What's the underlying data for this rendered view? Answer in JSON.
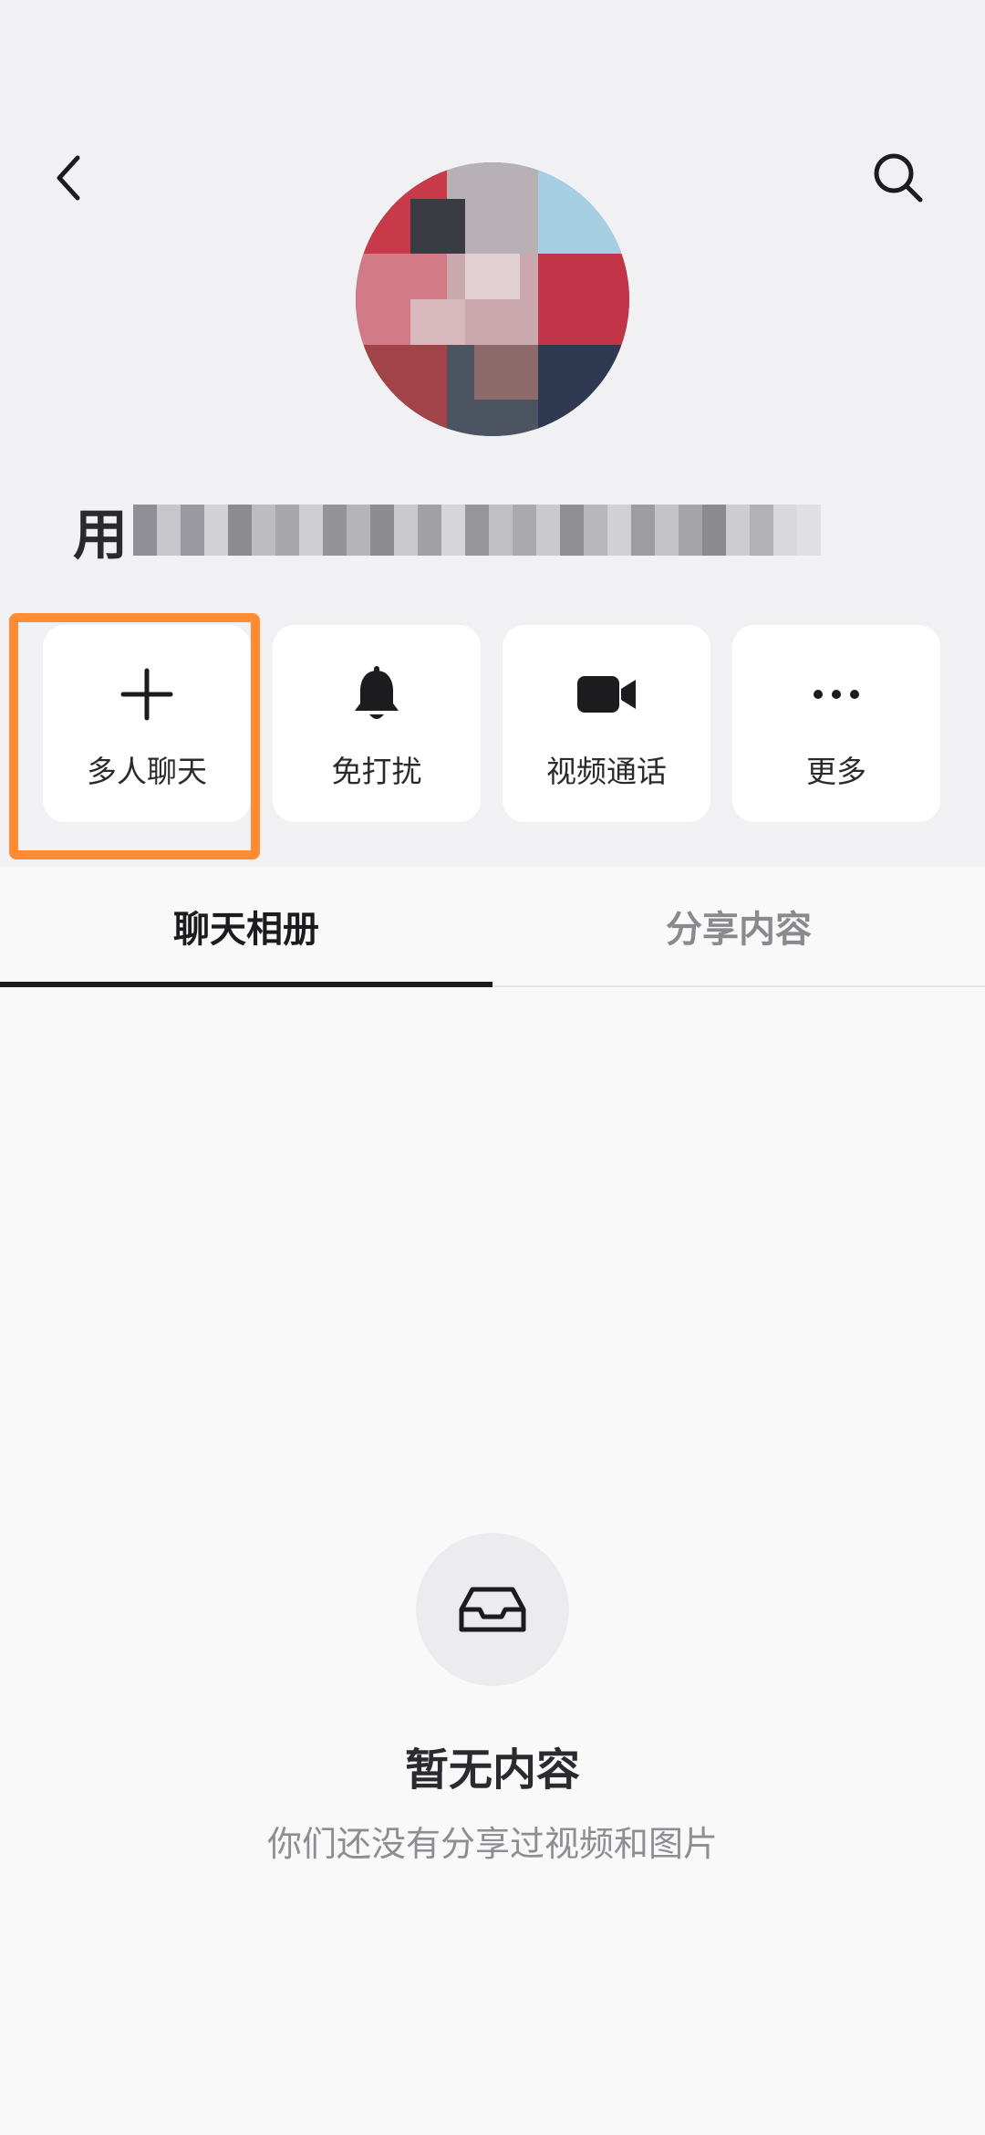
{
  "header": {
    "back_icon": "chevron-left-icon",
    "search_icon": "search-icon"
  },
  "profile": {
    "name_visible_prefix": "用",
    "name_obscured": true
  },
  "actions": [
    {
      "label": "多人聊天",
      "icon": "plus-icon"
    },
    {
      "label": "免打扰",
      "icon": "bell-icon"
    },
    {
      "label": "视频通话",
      "icon": "video-camera-icon"
    },
    {
      "label": "更多",
      "icon": "more-dots-icon"
    }
  ],
  "tabs": [
    {
      "label": "聊天相册",
      "active": true
    },
    {
      "label": "分享内容",
      "active": false
    }
  ],
  "empty_state": {
    "icon": "inbox-icon",
    "title": "暂无内容",
    "subtitle": "你们还没有分享过视频和图片"
  },
  "colors": {
    "highlight": "#ff8c33",
    "header_bg": "#f1f1f3",
    "page_bg": "#f9f9f9",
    "card_bg": "#ffffff",
    "text_primary": "#1c1c1e",
    "text_secondary": "#8e8e92"
  }
}
